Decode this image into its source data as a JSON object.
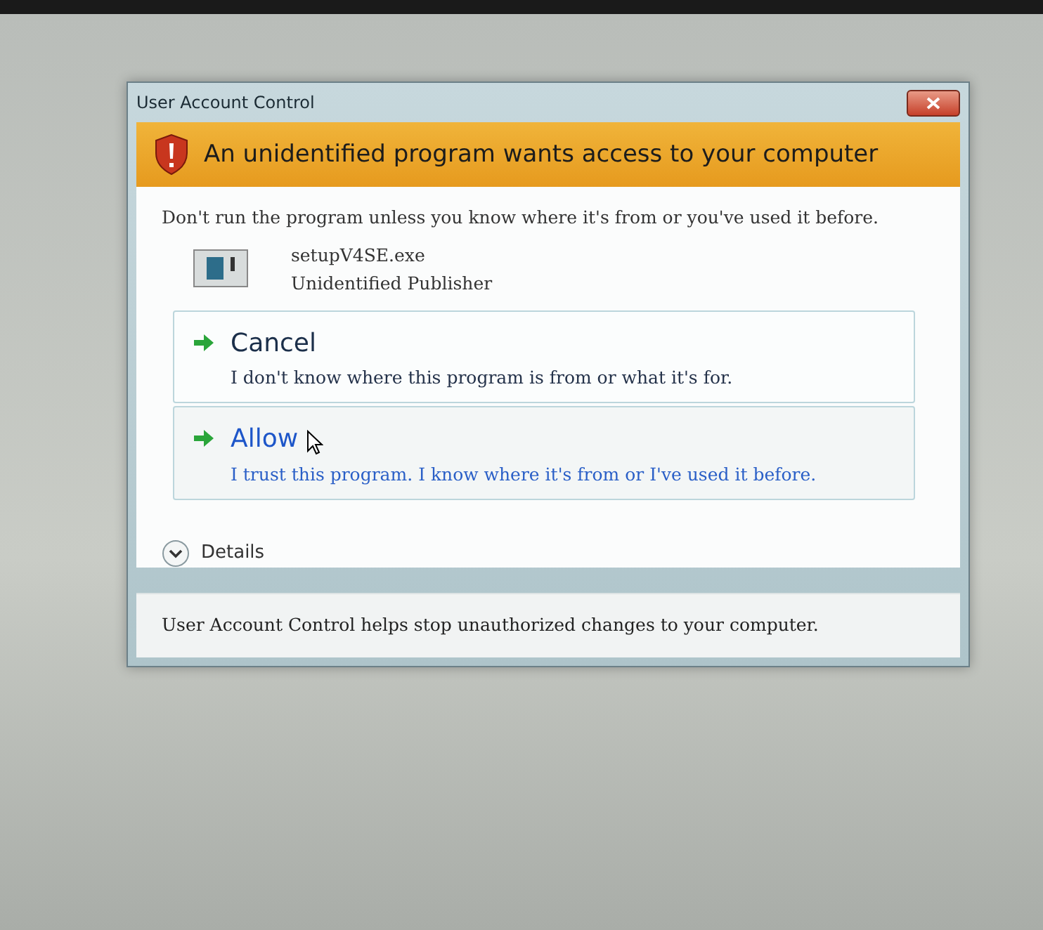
{
  "window": {
    "title": "User Account Control"
  },
  "banner": {
    "text": "An unidentified program wants access to your computer"
  },
  "message": "Don't run the program unless you know where it's from or you've used it before.",
  "program": {
    "name": "setupV4SE.exe",
    "publisher": "Unidentified Publisher"
  },
  "options": [
    {
      "kind": "cancel",
      "title": "Cancel",
      "description": "I don't know where this program is from or what it's for."
    },
    {
      "kind": "allow",
      "title": "Allow",
      "description": "I trust this program. I know where it's from or I've used it before."
    }
  ],
  "details": {
    "label": "Details",
    "expanded": false
  },
  "footer": "User Account Control helps stop unauthorized changes to your computer."
}
